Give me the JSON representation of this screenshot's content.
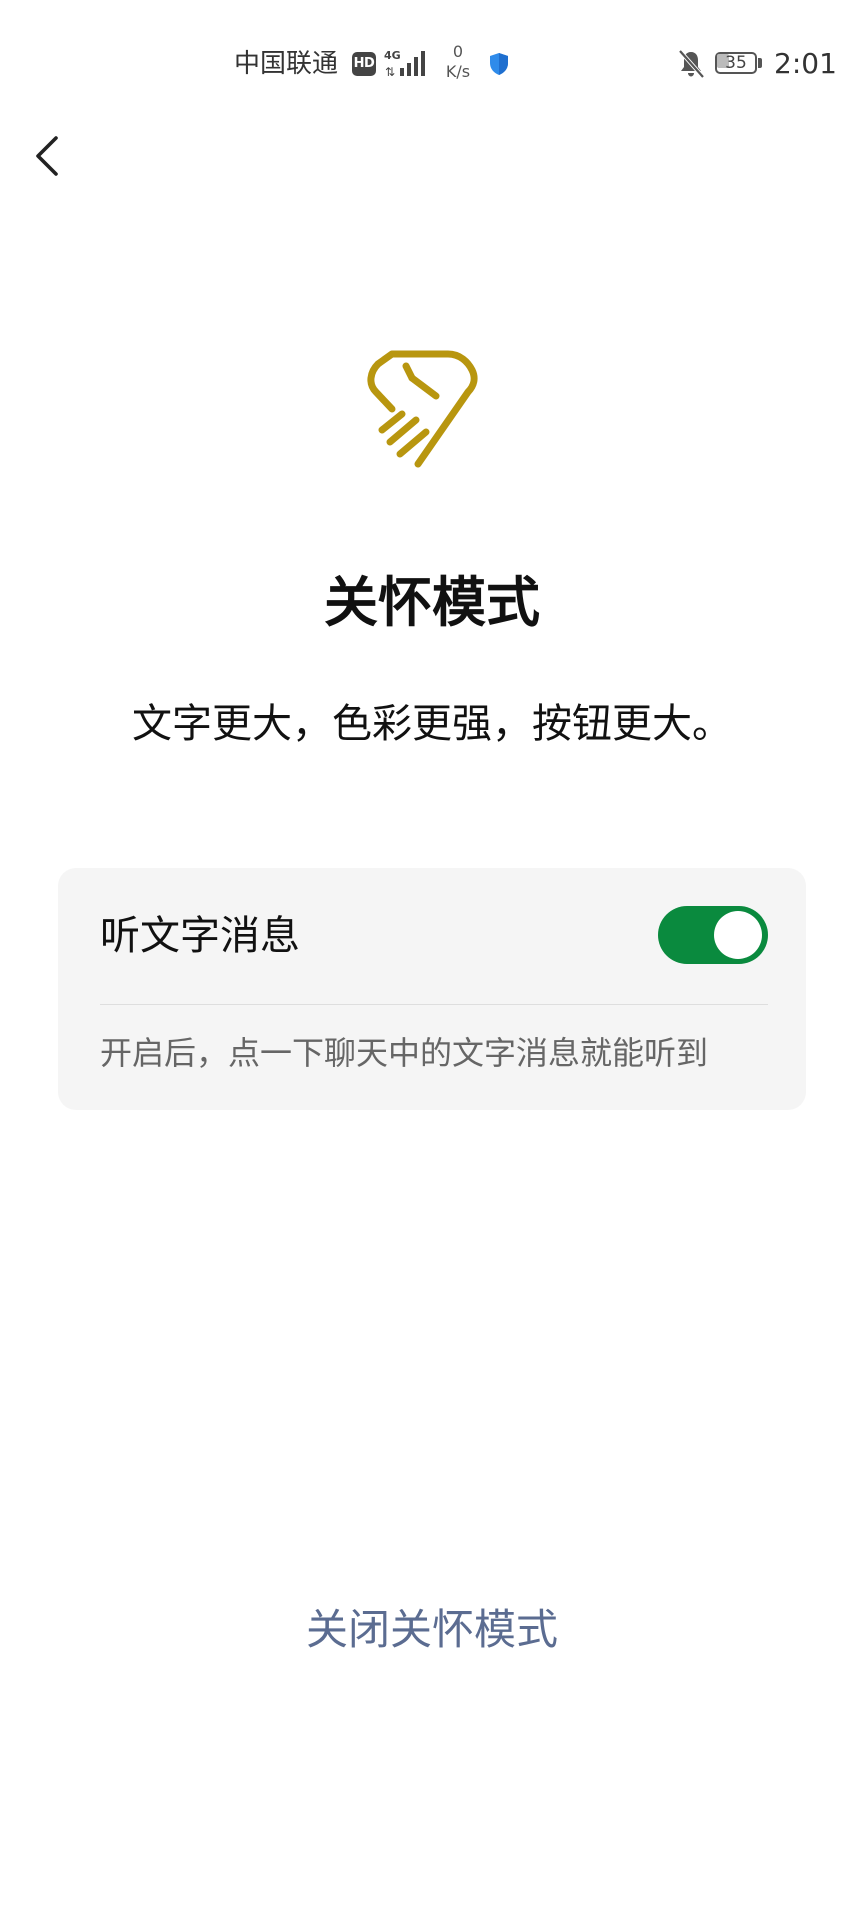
{
  "status_bar": {
    "carrier": "中国联通",
    "hd": "HD",
    "network": "4G",
    "speed_value": "0",
    "speed_unit": "K/s",
    "battery_level": "35",
    "time": "2:01"
  },
  "icons": {
    "back": "chevron-left-icon",
    "hero": "care-heart-hand-icon",
    "shield": "shield-icon",
    "bell": "bell-off-icon"
  },
  "colors": {
    "hero_icon": "#b8960f",
    "toggle_on": "#0a8a3e",
    "link": "#5b6c91"
  },
  "main": {
    "title": "关怀模式",
    "subtitle": "文字更大，色彩更强，按钮更大。"
  },
  "card": {
    "label": "听文字消息",
    "toggle_on": true,
    "hint": "开启后，点一下聊天中的文字消息就能听到"
  },
  "footer": {
    "close_label": "关闭关怀模式"
  }
}
